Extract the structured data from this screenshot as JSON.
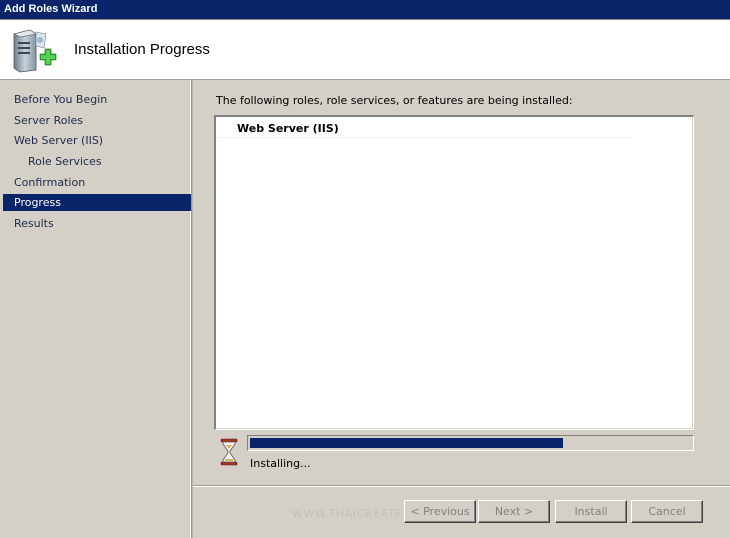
{
  "window": {
    "title": "Add Roles Wizard"
  },
  "header": {
    "title": "Installation Progress",
    "icon": "server-add-icon"
  },
  "sidebar": {
    "items": [
      {
        "label": "Before You Begin"
      },
      {
        "label": "Server Roles"
      },
      {
        "label": "Web Server (IIS)"
      },
      {
        "label": "Role Services"
      },
      {
        "label": "Confirmation"
      },
      {
        "label": "Progress"
      },
      {
        "label": "Results"
      }
    ],
    "active": "Progress"
  },
  "main": {
    "intro": "The following roles, role services, or features are being installed:",
    "items": [
      {
        "label": "Web Server (IIS)"
      }
    ],
    "progress": 0.71,
    "status": "Installing..."
  },
  "footer": {
    "watermark": "WWW.THAICREATE.C",
    "buttons": {
      "previous": "< Previous",
      "next": "Next >",
      "install": "Install",
      "cancel": "Cancel"
    }
  },
  "colors": {
    "titlebar": "#0a246a",
    "selection": "#0a246a",
    "progress_fill": "#0a246a",
    "window_bg": "#d4d0c8"
  }
}
